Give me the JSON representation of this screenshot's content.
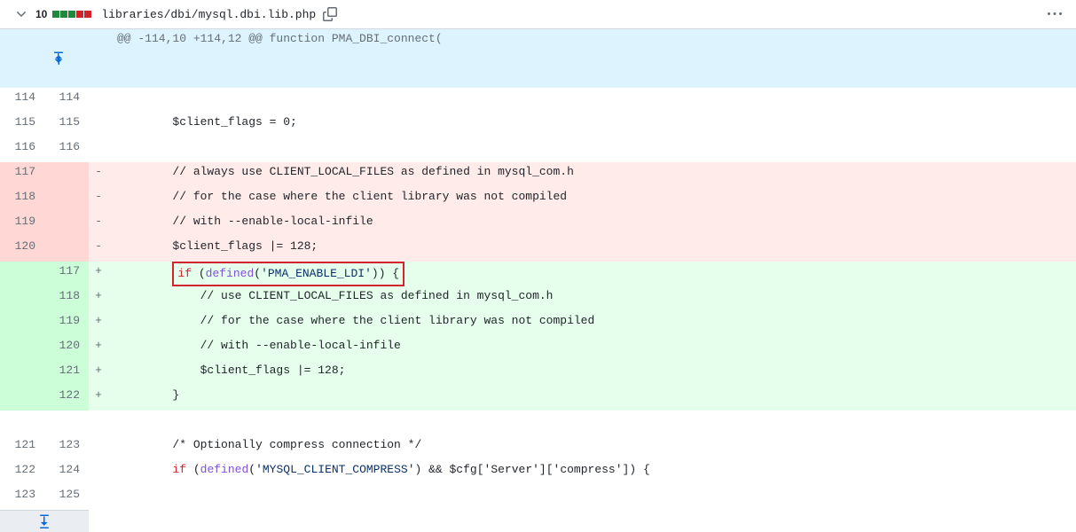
{
  "header": {
    "count": "10",
    "filepath": "libraries/dbi/mysql.dbi.lib.php"
  },
  "hunk": {
    "header": "@@ -114,10 +114,12 @@ function PMA_DBI_connect("
  },
  "lines": [
    {
      "t": "ctx",
      "ol": "114",
      "nl": "114",
      "m": " ",
      "code": ""
    },
    {
      "t": "ctx",
      "ol": "115",
      "nl": "115",
      "m": " ",
      "code": "        $client_flags = 0;"
    },
    {
      "t": "ctx",
      "ol": "116",
      "nl": "116",
      "m": " ",
      "code": ""
    },
    {
      "t": "del",
      "ol": "117",
      "nl": "",
      "m": "-",
      "code": "        // always use CLIENT_LOCAL_FILES as defined in mysql_com.h"
    },
    {
      "t": "del",
      "ol": "118",
      "nl": "",
      "m": "-",
      "code": "        // for the case where the client library was not compiled"
    },
    {
      "t": "del",
      "ol": "119",
      "nl": "",
      "m": "-",
      "code": "        // with --enable-local-infile"
    },
    {
      "t": "del",
      "ol": "120",
      "nl": "",
      "m": "-",
      "code": "        $client_flags |= 128;"
    },
    {
      "t": "add",
      "ol": "",
      "nl": "117",
      "m": "+",
      "box": true,
      "pre": "        ",
      "kw": "if",
      "paren": " (",
      "fn": "defined",
      "arg": "'PMA_ENABLE_LDI'",
      "suffix": ")) {"
    },
    {
      "t": "add",
      "ol": "",
      "nl": "118",
      "m": "+",
      "code": "            // use CLIENT_LOCAL_FILES as defined in mysql_com.h"
    },
    {
      "t": "add",
      "ol": "",
      "nl": "119",
      "m": "+",
      "code": "            // for the case where the client library was not compiled"
    },
    {
      "t": "add",
      "ol": "",
      "nl": "120",
      "m": "+",
      "code": "            // with --enable-local-infile"
    },
    {
      "t": "add",
      "ol": "",
      "nl": "121",
      "m": "+",
      "code": "            $client_flags |= 128;"
    },
    {
      "t": "add",
      "ol": "",
      "nl": "122",
      "m": "+",
      "code": "        }"
    },
    {
      "t": "ctx",
      "ol": "",
      "nl": "",
      "m": " ",
      "code": ""
    },
    {
      "t": "ctx",
      "ol": "121",
      "nl": "123",
      "m": " ",
      "code": "        /* Optionally compress connection */"
    },
    {
      "t": "ctx",
      "ol": "122",
      "nl": "124",
      "m": " ",
      "kw": "if",
      "pre": "        ",
      "paren": " (",
      "fn": "defined",
      "arg": "'MYSQL_CLIENT_COMPRESS'",
      "suffix": ") && $cfg['Server']['compress']) {"
    },
    {
      "t": "ctx",
      "ol": "123",
      "nl": "125",
      "m": " ",
      "code": ""
    }
  ]
}
